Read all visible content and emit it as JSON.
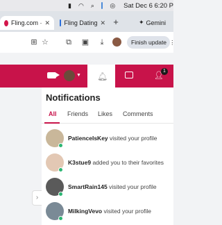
{
  "menubar": {
    "clock": "Sat Dec 6  6:20 P"
  },
  "tabs": [
    {
      "label": "Fling.com ·",
      "active": true
    },
    {
      "label": "Fling Dating",
      "active": false
    }
  ],
  "gemini_label": "Gemini",
  "toolbar": {
    "finish_update": "Finish update"
  },
  "header": {
    "notification_count": "1"
  },
  "notifications": {
    "title": "Notifications",
    "filters": [
      "All",
      "Friends",
      "Likes",
      "Comments"
    ],
    "active_filter": "All",
    "items": [
      {
        "name": "PatienceIsKey",
        "action": " visited your profile",
        "avatar_color": "#c9b79a"
      },
      {
        "name": "K3stue9",
        "action": " added you to their favorites",
        "avatar_color": "#e3c8b4"
      },
      {
        "name": "SmartRain145",
        "action": " visited your profile",
        "avatar_color": "#5a5a5a"
      },
      {
        "name": "MilkingVevo",
        "action": " visited your profile",
        "avatar_color": "#7a8a96"
      }
    ]
  },
  "colors": {
    "brand": "#c8134a",
    "online": "#2bb673"
  }
}
